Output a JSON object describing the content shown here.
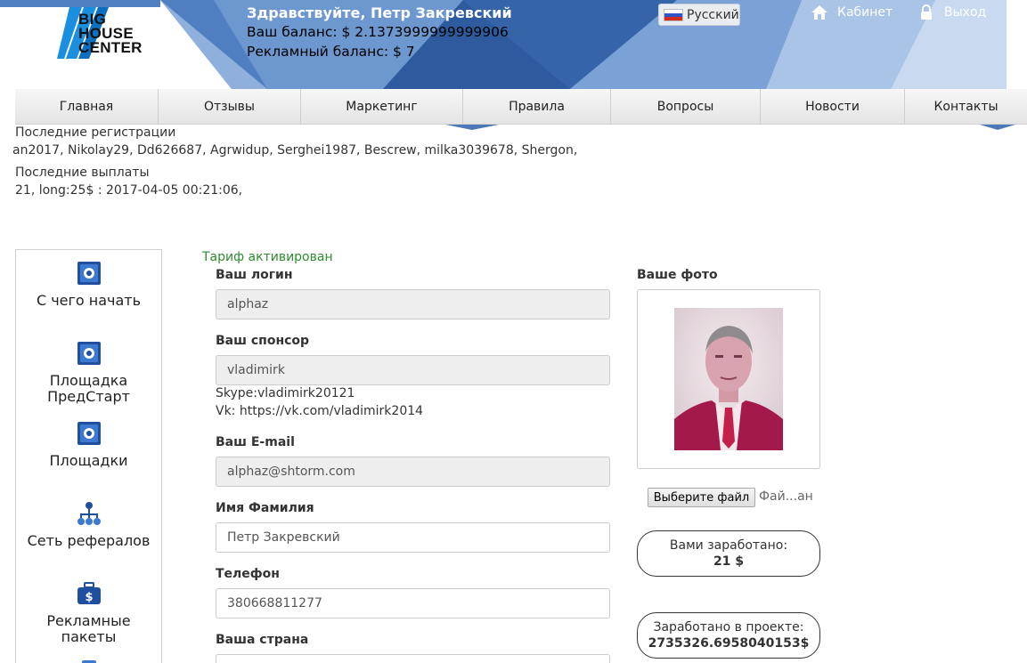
{
  "header": {
    "logo_text_lines": [
      "BIG",
      "HOUSE",
      "CENTER"
    ],
    "greeting": "Здравствуйте, Петр Закревский",
    "balance": "Ваш баланс: $ 2.1373999999999906",
    "ad_balance": "Рекламный баланс: $ 7",
    "language": "Русский",
    "cabinet": "Кабинет",
    "logout": "Выход"
  },
  "nav": {
    "items": [
      "Главная",
      "Отзывы",
      "Маркетинг",
      "Правила",
      "Вопросы",
      "Новости",
      "Контакты"
    ]
  },
  "tickers": {
    "registrations_label": "Последние регистрации",
    "registrations_value": "an2017, Nikolay29, Dd626687, Agrwidup, Serghei1987, Bescrew, milka3039678, Shergon,",
    "payouts_label": "Последние выплаты",
    "payouts_value": "21, long:25$ : 2017-04-05 00:21:06,"
  },
  "sidebar": {
    "items": [
      {
        "label": "С чего начать",
        "icon": "safe-icon"
      },
      {
        "label": "Площадка ПредСтарт",
        "icon": "safe-icon"
      },
      {
        "label": "Площадки",
        "icon": "safe-icon"
      },
      {
        "label": "Сеть рефералов",
        "icon": "network-icon"
      },
      {
        "label": "Рекламные пакеты",
        "icon": "briefcase-icon"
      }
    ]
  },
  "form": {
    "status": "Тариф активирован",
    "login_label": "Ваш логин",
    "login_value": "alphaz",
    "sponsor_label": "Ваш спонсор",
    "sponsor_value": "vladimirk",
    "sponsor_skype": "Skype:vladimirk20121",
    "sponsor_vk": "Vk: https://vk.com/vladimirk2014",
    "email_label": "Ваш E-mail",
    "email_value": "alphaz@shtorm.com",
    "name_label": "Имя Фамилия",
    "name_value": "Петр Закревский",
    "phone_label": "Телефон",
    "phone_value": "380668811277",
    "country_label": "Ваша страна"
  },
  "photo": {
    "label": "Ваше фото",
    "choose_file": "Выберите файл",
    "file_name": "Фай...ан"
  },
  "stats": {
    "earned_label": "Вами заработано:",
    "earned_value": "21 $",
    "project_label": "Заработано в проекте:",
    "project_value": "2735326.6958040153$"
  },
  "colors": {
    "header_blue": "#3f71b6",
    "status_green": "#2e8b2e",
    "readonly_bg": "#eeeeee"
  }
}
